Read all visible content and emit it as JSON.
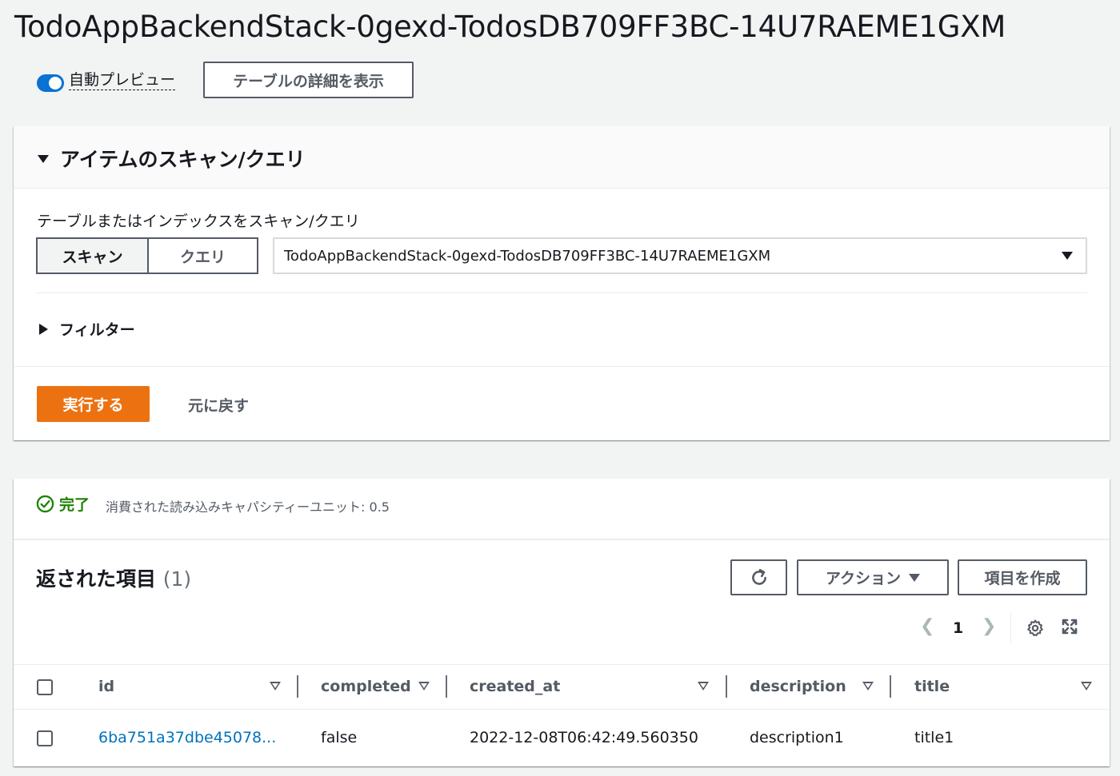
{
  "page": {
    "title": "TodoAppBackendStack-0gexd-TodosDB709FF3BC-14U7RAEME1GXM",
    "auto_preview_label": "自動プレビュー",
    "table_details_button": "テーブルの詳細を表示"
  },
  "scan_panel": {
    "title": "アイテムのスキャン/クエリ",
    "scan_label": "テーブルまたはインデックスをスキャン/クエリ",
    "scan_tab": "スキャン",
    "query_tab": "クエリ",
    "selected_table": "TodoAppBackendStack-0gexd-TodosDB709FF3BC-14U7RAEME1GXM",
    "filter_label": "フィルター",
    "run_button": "実行する",
    "reset_button": "元に戻す"
  },
  "results": {
    "status": "完了",
    "status_detail": "消費された読み込みキャパシティーユニット: 0.5",
    "title": "返された項目",
    "count": "(1)",
    "actions_button": "アクション",
    "create_button": "項目を作成",
    "page_number": "1",
    "columns": [
      "id",
      "completed",
      "created_at",
      "description",
      "title"
    ],
    "rows": [
      {
        "id": "6ba751a37dbe45078...",
        "completed": "false",
        "created_at": "2022-12-08T06:42:49.560350",
        "description": "description1",
        "title": "title1"
      }
    ]
  },
  "colors": {
    "accent": "#0972d3",
    "primary_button": "#ec7211",
    "success": "#1d8102",
    "link": "#0073bb"
  }
}
